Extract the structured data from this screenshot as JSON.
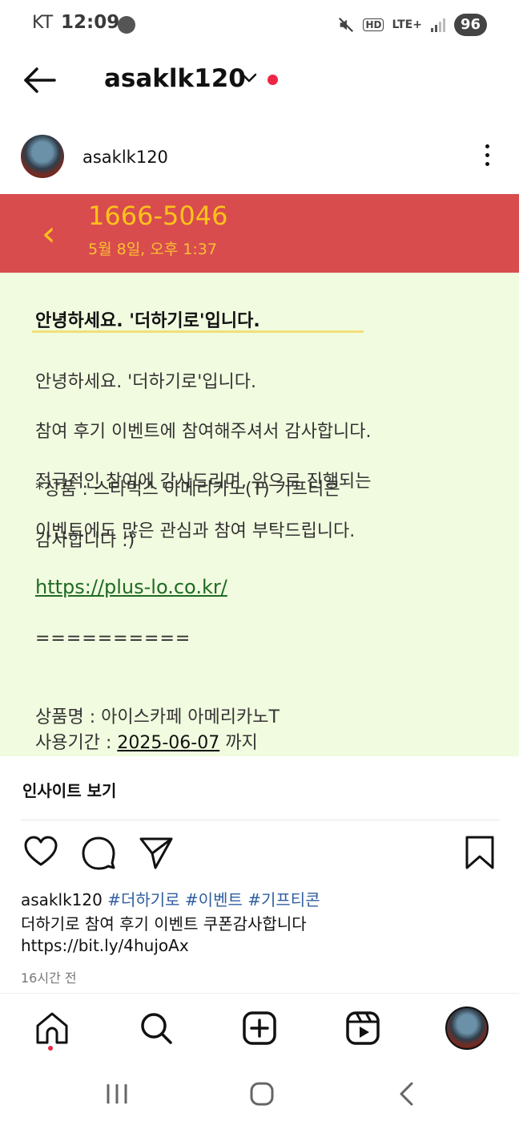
{
  "status_bar": {
    "carrier": "KT",
    "time": "12:09",
    "battery": "96",
    "hd_label": "HD",
    "network": "LTE+"
  },
  "header": {
    "username": "asaklk120"
  },
  "post": {
    "username": "asaklk120",
    "image": {
      "sender": "1666-5046",
      "timestamp": "5월 8일, 오후 1:37",
      "title": "안녕하세요. '더하기로'입니다.",
      "body_lines": [
        "안녕하세요. '더하기로'입니다.",
        "참여 후기 이벤트에 참여해주셔서 감사합니다.",
        "적극적인 참여에 감사드리며, 앞으로 진행되는",
        "이벤트에도 많은 관심과 참여 부탁드립니다."
      ],
      "product": "*상품 : 스타벅스 아메리카노(T) 기프티콘",
      "thanks": "감사합니다 :)",
      "link": "https://plus-lo.co.kr/",
      "divider": "==========",
      "product_name": "상품명 : 아이스카페 아메리카노T",
      "period_label": "사용기간 : ",
      "period_date": "2025-06-07",
      "period_suffix": " 까지"
    },
    "insights_label": "인사이트 보기",
    "caption": {
      "username": "asaklk120",
      "tags": [
        "#더하기로",
        "#이벤트",
        "#기프티콘"
      ],
      "line2": "더하기로 참여 후기 이벤트 쿠폰감사합니다",
      "line3": "https://bit.ly/4hujoAx"
    },
    "time_ago": "16시간 전"
  }
}
